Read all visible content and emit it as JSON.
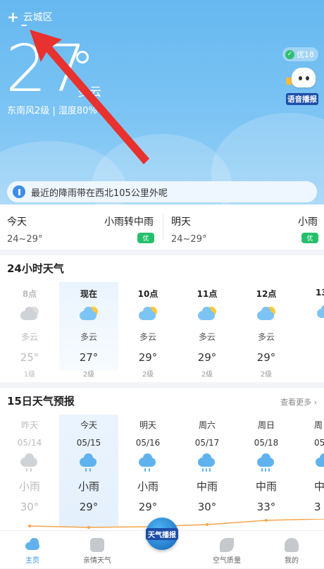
{
  "header": {
    "location": "云城区",
    "temperature": "27",
    "condition": "多云",
    "wind_humidity": "东南风2级 | 湿度80%",
    "aqi_badge": "优18",
    "voice_label": "语音播报"
  },
  "alert": {
    "text": "最近的降雨带在西北105公里外呢"
  },
  "today": {
    "name": "今天",
    "range": "24~29°",
    "condition": "小雨转中雨",
    "aqi": "优"
  },
  "tomorrow": {
    "name": "明天",
    "range": "24~29°",
    "condition": "小雨",
    "aqi": "优"
  },
  "hourly": {
    "title": "24小时天气",
    "items": [
      {
        "time": "8点",
        "cond": "多云",
        "temp": "25°",
        "wind": "1级",
        "icon": "partly-cloudy-icon"
      },
      {
        "time": "现在",
        "cond": "多云",
        "temp": "27°",
        "wind": "2级",
        "icon": "partly-cloudy-icon"
      },
      {
        "time": "10点",
        "cond": "多云",
        "temp": "29°",
        "wind": "2级",
        "icon": "partly-cloudy-icon"
      },
      {
        "time": "11点",
        "cond": "多云",
        "temp": "29°",
        "wind": "2级",
        "icon": "partly-cloudy-icon"
      },
      {
        "time": "12点",
        "cond": "多云",
        "temp": "29°",
        "wind": "2级",
        "icon": "partly-cloudy-icon"
      },
      {
        "time": "13",
        "cond": "",
        "temp": "",
        "wind": "",
        "icon": "partly-cloudy-icon"
      }
    ]
  },
  "daily": {
    "title": "15日天气预报",
    "more": "查看更多",
    "items": [
      {
        "name": "昨天",
        "date": "05/14",
        "cond": "小雨",
        "temp": "30°",
        "icon": "rain-icon"
      },
      {
        "name": "今天",
        "date": "05/15",
        "cond": "小雨",
        "temp": "29°",
        "icon": "rain-icon"
      },
      {
        "name": "明天",
        "date": "05/16",
        "cond": "小雨",
        "temp": "29°",
        "icon": "rain-icon"
      },
      {
        "name": "周六",
        "date": "05/17",
        "cond": "中雨",
        "temp": "30°",
        "icon": "heavy-rain-icon"
      },
      {
        "name": "周日",
        "date": "05/18",
        "cond": "中雨",
        "temp": "33°",
        "icon": "heavy-rain-icon"
      },
      {
        "name": "周",
        "date": "05",
        "cond": "中",
        "temp": "3",
        "icon": "rain-icon"
      }
    ]
  },
  "tabs": {
    "home": "主页",
    "family": "亲情天气",
    "center": "天气播报",
    "air": "空气质量",
    "me": "我的"
  },
  "colors": {
    "accent": "#2e8ee8",
    "hero_top": "#66b8f0",
    "aqi_green": "#26c06d",
    "arrow_red": "#e8322f"
  }
}
